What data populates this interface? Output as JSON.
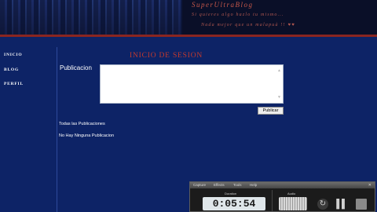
{
  "header": {
    "site_title": "SuperUltraBlog",
    "tagline_line1": "Si quieres algo hazlo tu mismo...",
    "tagline_line2": "Nada mejor que un malapuà !! ♥♥"
  },
  "sidebar": {
    "items": [
      {
        "label": "INICIO"
      },
      {
        "label": "BLOG"
      },
      {
        "label": "PERFIL"
      }
    ]
  },
  "main": {
    "heading": "INICIO DE SESION",
    "publication_label": "Publicacion",
    "publish_button": "Publicar",
    "all_publications_link": "Todas las Publicaciones",
    "no_publications": "No Hay Ninguna Publicacion"
  },
  "recorder": {
    "menu": [
      "Capture",
      "Effects",
      "Tools",
      "Help"
    ],
    "duration_label": "Duration",
    "duration": "0:05:54",
    "audio_label": "Audio",
    "colors": {
      "panel": "#1b1b1b",
      "display": "#dfe6ea"
    }
  },
  "colors": {
    "page_bg": "#0d2366",
    "accent_red": "#c6392c",
    "divider": "#8a2520"
  }
}
